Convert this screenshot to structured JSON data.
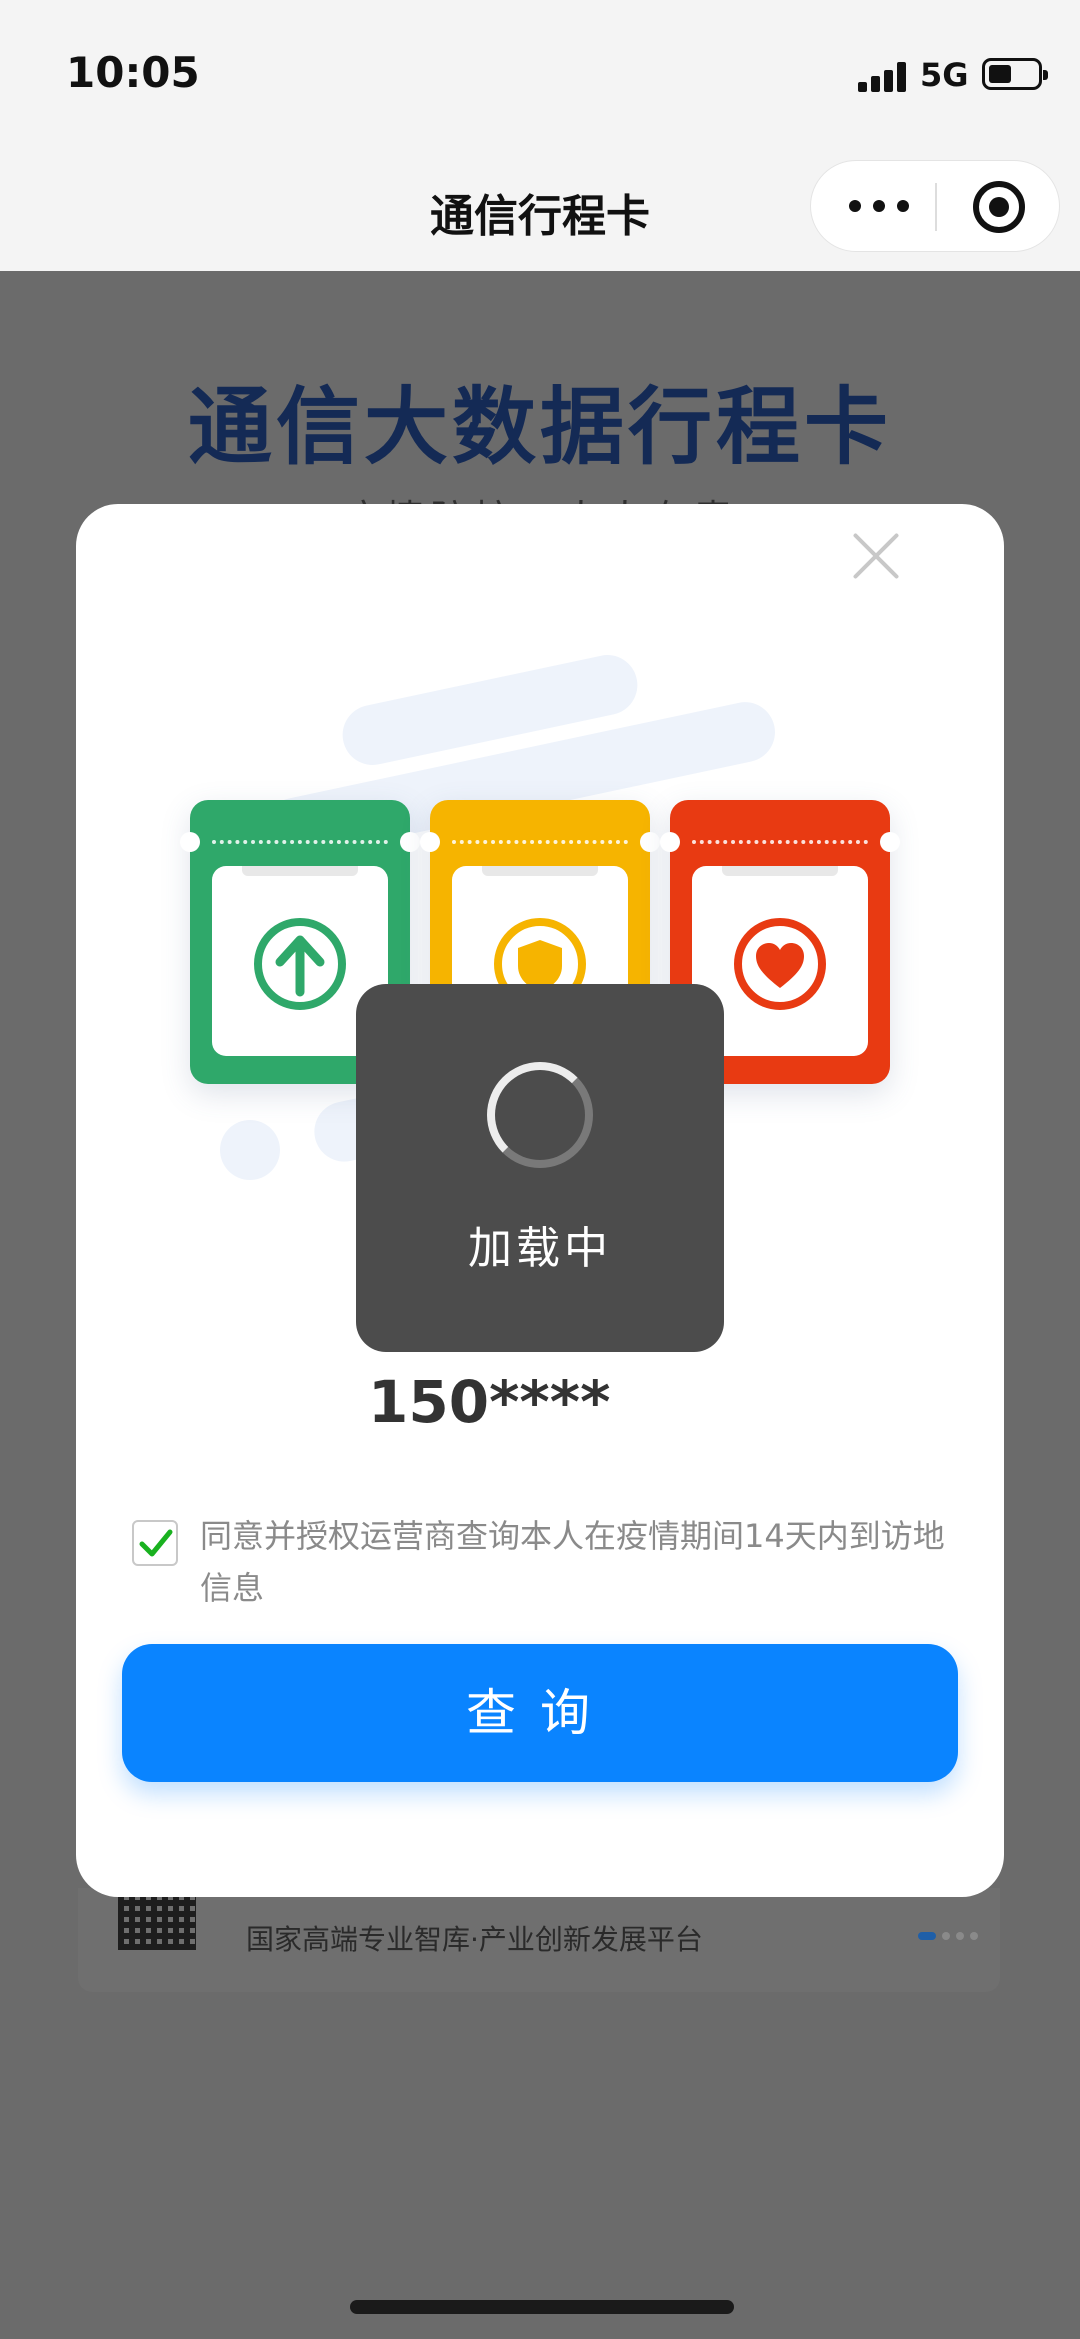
{
  "status_bar": {
    "time": "10:05",
    "network": "5G"
  },
  "nav": {
    "title": "通信行程卡"
  },
  "background": {
    "title": "通信大数据行程卡",
    "subtitle": "疫情防控，人人有责",
    "footer_text": "国家高端专业智库·产业创新发展平台"
  },
  "modal": {
    "tickets": [
      {
        "color": "#2fa86a",
        "icon": "arrow-up-icon"
      },
      {
        "color": "#f6b400",
        "icon": "shield-icon"
      },
      {
        "color": "#e83a12",
        "icon": "heart-icon"
      }
    ],
    "loading_text": "加载中",
    "phone_masked": "150****",
    "agreement": {
      "checked": true,
      "text": "同意并授权运营商查询本人在疫情期间14天内到访地信息"
    },
    "query_button_label": "查询"
  },
  "colors": {
    "primary": "#0a84ff",
    "title_navy": "#142a55"
  }
}
